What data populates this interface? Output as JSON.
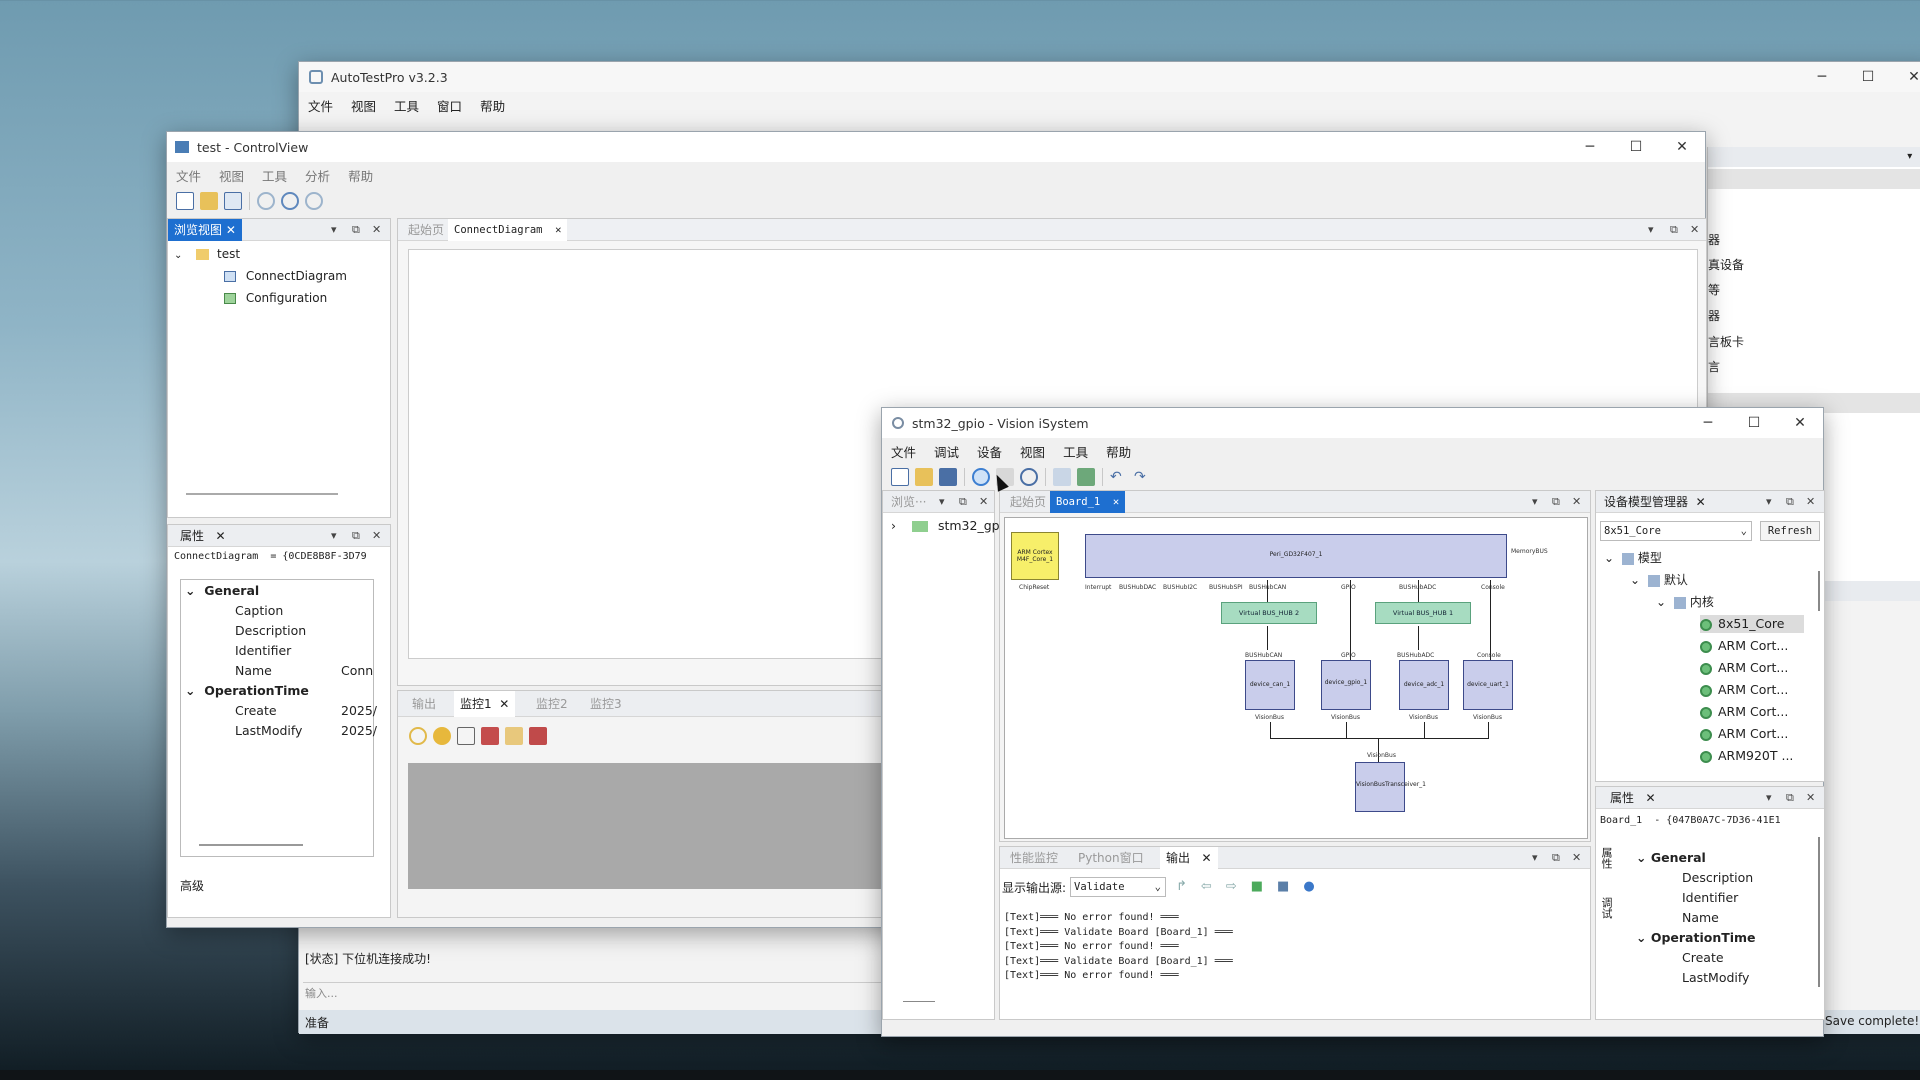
{
  "back_window": {
    "title": "AutoTestPro v3.2.3",
    "menu": [
      "文件",
      "视图",
      "工具",
      "窗口",
      "帮助"
    ],
    "right_panel_items": [
      "器",
      "真设备",
      "等",
      "器",
      "言板卡",
      "言"
    ],
    "log_line": "[状态] 下位机连接成功!",
    "input_placeholder": "输入...",
    "status": "准备",
    "status_right": "Save complete!"
  },
  "control_view": {
    "title": "test - ControlView",
    "menu": [
      "文件",
      "视图",
      "工具",
      "分析",
      "帮助"
    ],
    "browse_tab": "浏览视图",
    "tree": {
      "root": "test",
      "children": [
        "ConnectDiagram",
        "Configuration"
      ]
    },
    "prop_tab": "属性",
    "prop_object": "ConnectDiagram",
    "prop_value": "= {0CDE8B8F-3D79",
    "groups": [
      {
        "name": "General",
        "rows": [
          [
            "Caption",
            ""
          ],
          [
            "Description",
            ""
          ],
          [
            "Identifier",
            ""
          ],
          [
            "Name",
            "Conn"
          ]
        ]
      },
      {
        "name": "OperationTime",
        "rows": [
          [
            "Create",
            "2025/"
          ],
          [
            "LastModify",
            "2025/"
          ]
        ]
      }
    ],
    "prop_footer": "高级",
    "doc_tabs": [
      "起始页",
      "ConnectDiagram"
    ],
    "bottom_tabs": [
      "输出",
      "监控1",
      "监控2",
      "监控3"
    ]
  },
  "vision": {
    "title": "stm32_gpio - Vision iSystem",
    "menu": [
      "文件",
      "调试",
      "设备",
      "视图",
      "工具",
      "帮助"
    ],
    "browse_tab": "浏览···",
    "tree_root": "stm32_gp",
    "doc_tabs": [
      "起始页",
      "Board_1"
    ],
    "diagram": {
      "core": "ARM Cortex M4F_Core_1",
      "core_label": "ChipReset",
      "peri": "Peri_GD32F407_1",
      "memory": "MemoryBUS",
      "ports": [
        "Interrupt",
        "BUSHubDAC",
        "BUSHubI2C",
        "BUSHubSPI",
        "BUSHubCAN",
        "GPIO",
        "BUSHubADC",
        "Console"
      ],
      "hub2": "Virtual BUS_HUB 2",
      "hub1": "Virtual BUS_HUB 1",
      "devices": [
        {
          "name": "device_can_1",
          "top": "BUSHubCAN",
          "bottom": "VisionBus"
        },
        {
          "name": "device_gpio_1",
          "top": "GPIO",
          "bottom": "VisionBus"
        },
        {
          "name": "device_adc_1",
          "top": "BUSHubADC",
          "bottom": "VisionBus"
        },
        {
          "name": "device_uart_1",
          "top": "Console",
          "bottom": "VisionBus"
        }
      ],
      "transceiver": "VisionBusTransceiver_1",
      "transceiver_label": "VisionBus"
    },
    "out_tabs": [
      "性能监控",
      "Python窗口",
      "输出"
    ],
    "out_source_label": "显示输出源:",
    "out_source": "Validate",
    "output_lines": [
      "[Text]═══ No error found! ═══",
      "[Text]═══ Validate Board [Board_1] ═══",
      "[Text]═══ No error found! ═══",
      "[Text]═══ Validate Board [Board_1] ═══",
      "[Text]═══ No error found! ═══"
    ],
    "device_mgr_tab": "设备模型管理器",
    "core_select": "8x51_Core",
    "refresh": "Refresh",
    "dm_tree": {
      "model": "模型",
      "default": "默认",
      "core": "内核",
      "items": [
        "8x51_Core",
        "ARM Cort...",
        "ARM Cort...",
        "ARM Cort...",
        "ARM Cort...",
        "ARM Cort...",
        "ARM920T ..."
      ]
    },
    "prop_tab": "属性",
    "prop_object": "Board_1",
    "prop_value": "- {047B0A7C-7D36-41E1",
    "side_labels": [
      "属性",
      "调试"
    ],
    "groups": [
      {
        "name": "General",
        "rows": [
          "Description",
          "Identifier",
          "Name"
        ]
      },
      {
        "name": "OperationTime",
        "rows": [
          "Create",
          "LastModify"
        ]
      }
    ]
  }
}
